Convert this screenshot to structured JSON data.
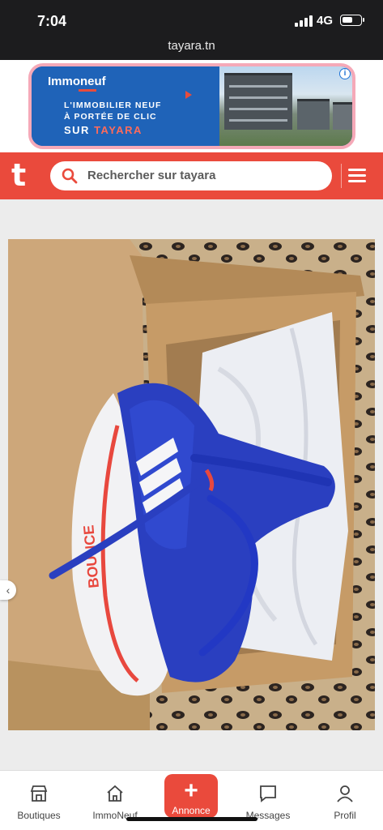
{
  "status_bar": {
    "time": "7:04",
    "network": "4G",
    "battery_level": 0.6
  },
  "browser": {
    "url": "tayara.tn"
  },
  "ad": {
    "brand": "Immoneuf",
    "line1": "L'IMMOBILIER NEUF",
    "line2": "À PORTÉE DE CLIC",
    "line3_prefix": "SUR ",
    "line3_highlight": "TAYARA",
    "info_label": "i"
  },
  "header": {
    "logo": "t",
    "search_placeholder": "Rechercher sur tayara"
  },
  "photo": {
    "shoe_text": "BOUNCE"
  },
  "bottom_nav": {
    "items": [
      {
        "label": "Boutiques",
        "icon": "shop-icon"
      },
      {
        "label": "ImmoNeuf",
        "icon": "home-icon"
      },
      {
        "label": "Annonce",
        "icon": "plus-icon"
      },
      {
        "label": "Messages",
        "icon": "message-icon"
      },
      {
        "label": "Profil",
        "icon": "user-icon"
      }
    ]
  },
  "colors": {
    "brand": "#ea4a3c",
    "ad_blue": "#1f63b8"
  }
}
